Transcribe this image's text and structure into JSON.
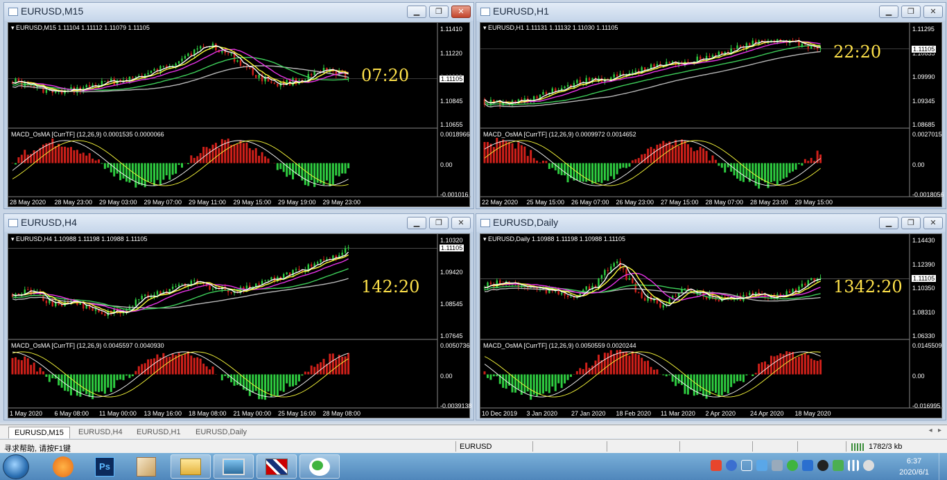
{
  "colors": {
    "bull": "#2ecc40",
    "bear": "#d0201a",
    "ma_white": "#ffffff",
    "ma_yellow": "#ffff3c",
    "ma_magenta": "#e833e8",
    "ma_green": "#3ecf5a",
    "ma_gray": "#b8b8b8",
    "timer": "#ffe24a"
  },
  "windows": [
    {
      "id": "m15",
      "title": "EURUSD,M15",
      "close_active": true,
      "symbol_line": "EURUSD,M15  1.11104 1.11112 1.11079 1.11105",
      "timer": "07:20",
      "price_labels": [
        "1.11410",
        "1.11220",
        "1.11030",
        "1.10845",
        "1.10655"
      ],
      "current_price": "1.11105",
      "macd_line": "MACD_OsMA [CurrTF] (12,26,9) 0.0001535 0.0000066",
      "macd_labels": [
        "0.0018966",
        "0.00",
        "-0.001016"
      ],
      "x_labels": [
        "28 May 2020",
        "28 May 23:00",
        "29 May 03:00",
        "29 May 07:00",
        "29 May 11:00",
        "29 May 15:00",
        "29 May 19:00",
        "29 May 23:00"
      ]
    },
    {
      "id": "h1",
      "title": "EURUSD,H1",
      "close_active": false,
      "symbol_line": "EURUSD,H1  1.11131 1.11132 1.11030 1.11105",
      "timer": "22:20",
      "price_labels": [
        "1.11295",
        "1.10635",
        "1.09990",
        "1.09345",
        "1.08685"
      ],
      "current_price": "1.11105",
      "macd_line": "MACD_OsMA [CurrTF] (12,26,9) 0.0009972 0.0014652",
      "macd_labels": [
        "0.0027015",
        "0.00",
        "-0.0018056"
      ],
      "x_labels": [
        "22 May 2020",
        "25 May 15:00",
        "26 May 07:00",
        "26 May 23:00",
        "27 May 15:00",
        "28 May 07:00",
        "28 May 23:00",
        "29 May 15:00"
      ]
    },
    {
      "id": "h4",
      "title": "EURUSD,H4",
      "close_active": false,
      "symbol_line": "EURUSD,H4  1.10988 1.11198 1.10988 1.11105",
      "timer": "142:20",
      "price_labels": [
        "1.10320",
        "1.09420",
        "1.08545",
        "1.07645"
      ],
      "current_price": "1.11105",
      "macd_line": "MACD_OsMA [CurrTF] (12,26,9) 0.0045597 0.0040930",
      "macd_labels": [
        "0.0050736",
        "0.00",
        "-0.0039138"
      ],
      "x_labels": [
        "1 May 2020",
        "6 May 08:00",
        "11 May 00:00",
        "13 May 16:00",
        "18 May 08:00",
        "21 May 00:00",
        "25 May 16:00",
        "28 May 08:00"
      ]
    },
    {
      "id": "d1",
      "title": "EURUSD,Daily",
      "close_active": false,
      "symbol_line": "EURUSD,Daily  1.10988 1.11198 1.10988 1.11105",
      "timer": "1342:20",
      "price_labels": [
        "1.14430",
        "1.12390",
        "1.10350",
        "1.08310",
        "1.06330"
      ],
      "current_price": "1.11105",
      "macd_line": "MACD_OsMA [CurrTF] (12,26,9) 0.0050559 0.0020244",
      "macd_labels": [
        "0.0145509",
        "0.00",
        "-0.016995"
      ],
      "x_labels": [
        "10 Dec 2019",
        "3 Jan 2020",
        "27 Jan 2020",
        "18 Feb 2020",
        "11 Mar 2020",
        "2 Apr 2020",
        "24 Apr 2020",
        "18 May 2020"
      ]
    }
  ],
  "tabs": [
    "EURUSD,M15",
    "EURUSD,H4",
    "EURUSD,H1",
    "EURUSD,Daily"
  ],
  "status": {
    "help": "寻求帮助, 请按F1键",
    "symbol": "EURUSD",
    "traffic": "1782/3 kb"
  },
  "clock": {
    "time": "6:37",
    "date": "2020/6/1"
  },
  "taskbar": {
    "apps": [
      "app-icon",
      "photoshop-icon",
      "paint-icon",
      "explorer-icon",
      "image-viewer-icon",
      "metatrader-icon",
      "wechat-icon"
    ]
  }
}
